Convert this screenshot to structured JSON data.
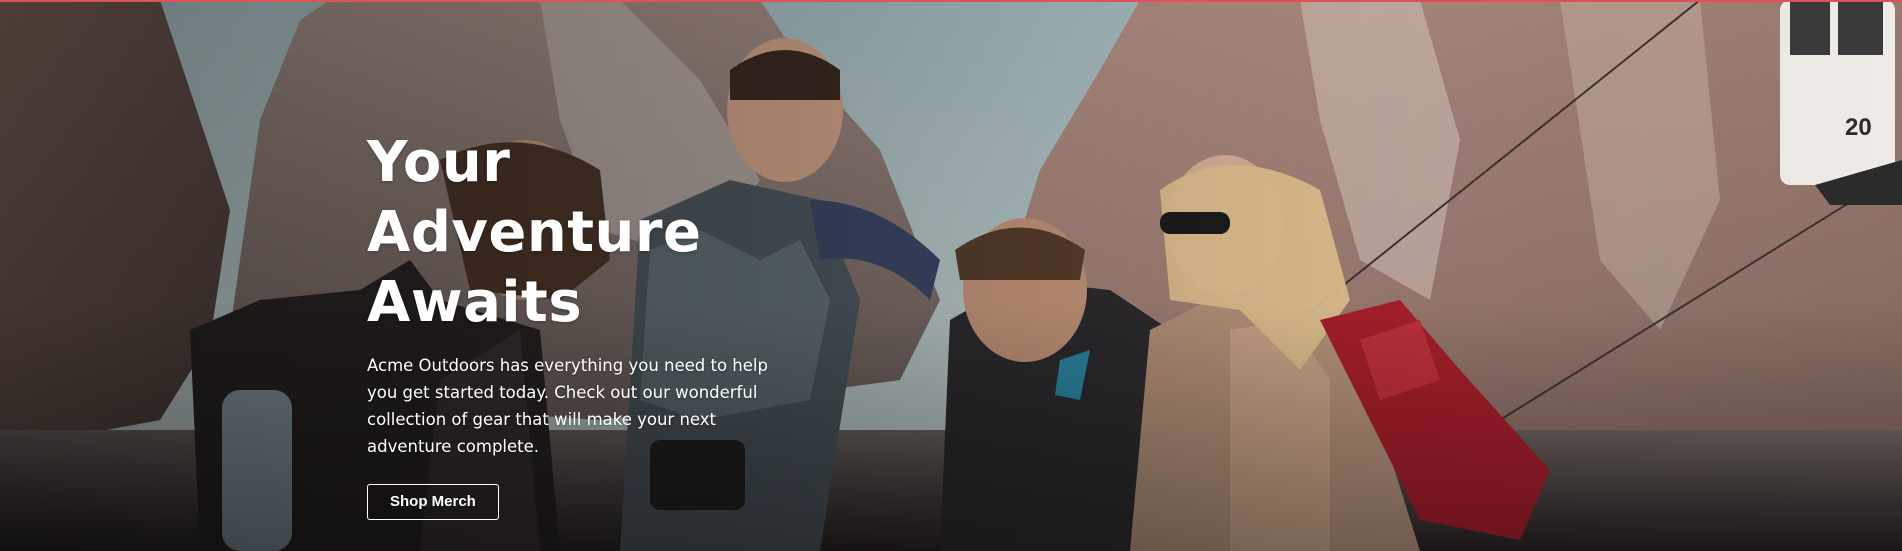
{
  "hero": {
    "title_line1": "Your Adventure",
    "title_line2": "Awaits",
    "description": "Acme Outdoors has everything you need to help you get started today. Check out our wonderful collection of gear that will make your next adventure complete.",
    "cta_label": "Shop Merch",
    "gondola_number": "20"
  },
  "colors": {
    "accent_bar": "#e0525a",
    "text": "#ffffff",
    "button_border": "#ffffff"
  },
  "icons": {
    "background": "hikers-mountain-photo"
  }
}
